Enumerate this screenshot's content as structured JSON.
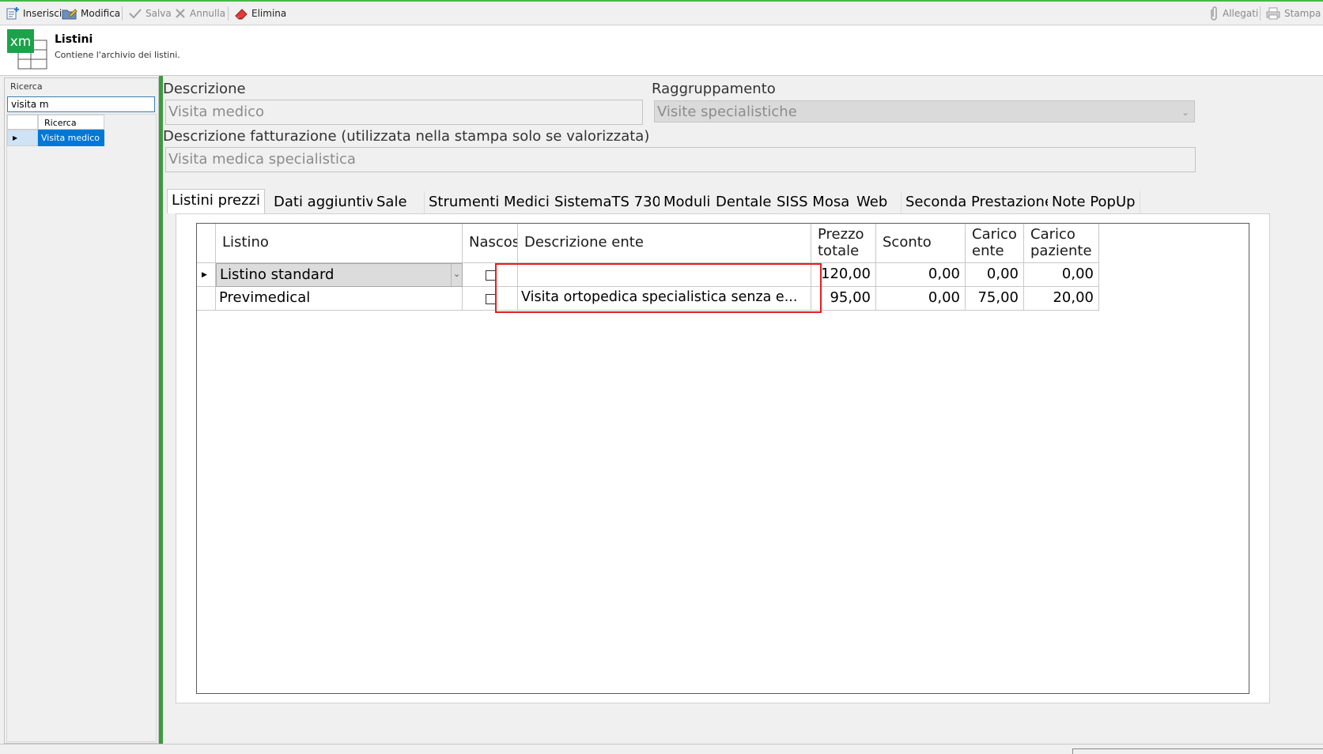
{
  "toolbar": {
    "insert": "Inserisci",
    "edit": "Modifica",
    "save": "Salva",
    "cancel": "Annulla",
    "delete": "Elimina",
    "attachments": "Allegati",
    "print": "Stampa"
  },
  "header": {
    "logo_text": "xm",
    "title": "Listini",
    "subtitle": "Contiene l'archivio dei listini."
  },
  "sidebar": {
    "search_label": "Ricerca",
    "search_value": "visita m",
    "grid_header": "Ricerca",
    "selected_item": "Visita medico"
  },
  "form": {
    "descrizione_label": "Descrizione",
    "descrizione_value": "Visita medico",
    "raggruppamento_label": "Raggruppamento",
    "raggruppamento_value": "Visite specialistiche",
    "descrizione_fatt_label": "Descrizione fatturazione (utilizzata nella stampa solo se valorizzata)",
    "descrizione_fatt_value": "Visita medica specialistica"
  },
  "tabs": [
    "Listini prezzi",
    "Dati aggiuntivi",
    "Sale",
    "Strumenti",
    "Medici",
    "SistemaTS 730",
    "Moduli",
    "Dentale",
    "SISS Mosa",
    "Web",
    "Seconda Prestazione",
    "Note PopUp"
  ],
  "grid": {
    "headers": {
      "listino": "Listino",
      "nascosto": "Nascos",
      "descrizione_ente": "Descrizione ente",
      "prezzo_totale_1": "Prezzo",
      "prezzo_totale_2": "totale",
      "sconto": "Sconto",
      "carico_ente_1": "Carico",
      "carico_ente_2": "ente",
      "carico_paziente_1": "Carico",
      "carico_paziente_2": "paziente"
    },
    "rows": [
      {
        "listino": "Listino standard",
        "nascosto": false,
        "descrizione_ente": "",
        "prezzo_totale": "120,00",
        "sconto": "0,00",
        "carico_ente": "0,00",
        "carico_paziente": "0,00"
      },
      {
        "listino": "Previmedical",
        "nascosto": false,
        "descrizione_ente": "Visita ortopedica specialistica senza e...",
        "prezzo_totale": "95,00",
        "sconto": "0,00",
        "carico_ente": "75,00",
        "carico_paziente": "20,00"
      }
    ]
  },
  "colors": {
    "accent_green": "#3c9a3c",
    "selection_blue": "#0078d7",
    "highlight_red": "#e81c1c"
  }
}
